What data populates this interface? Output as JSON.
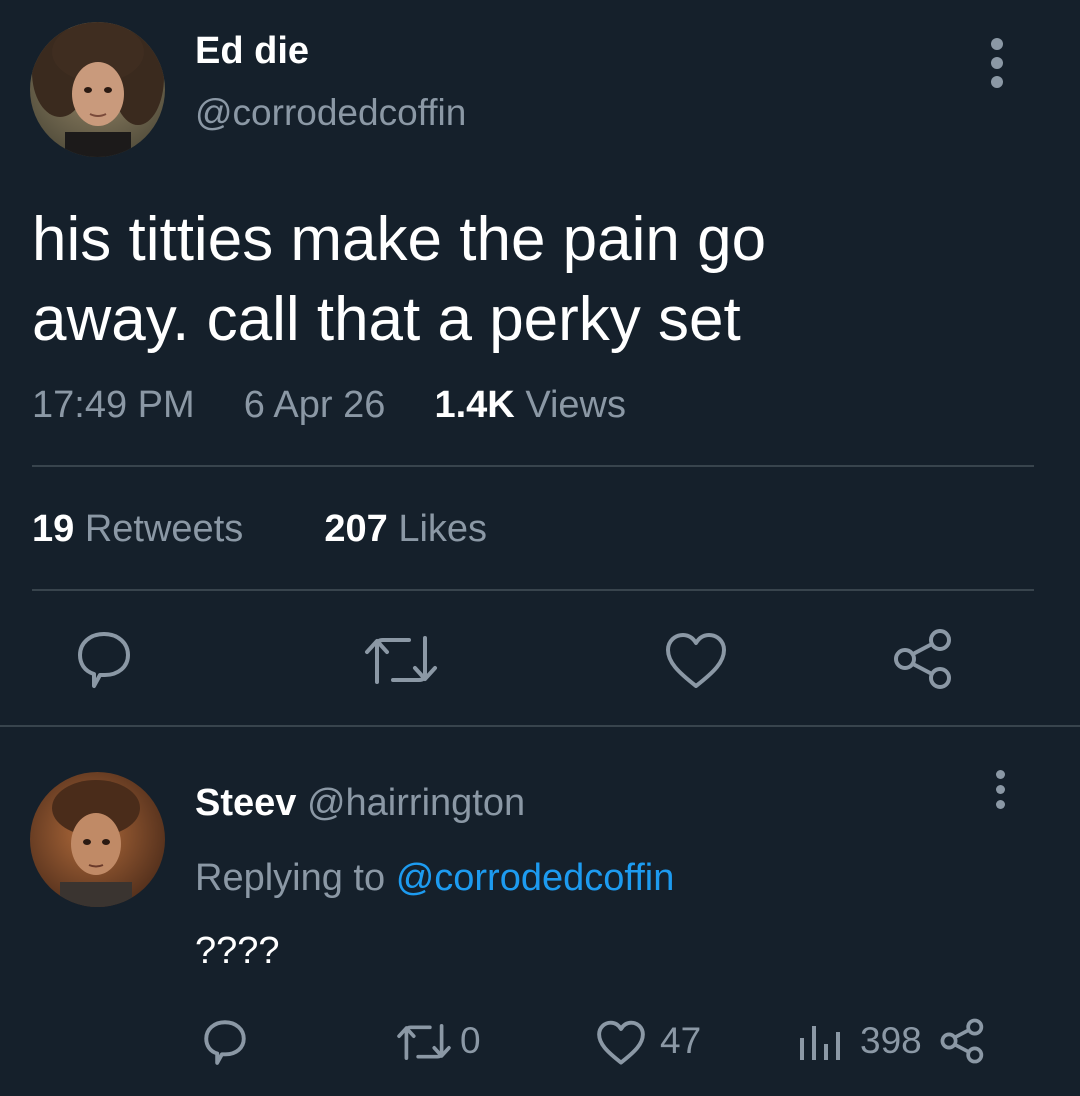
{
  "main_tweet": {
    "author_name": "Ed die",
    "author_handle": "@corrodedcoffin",
    "text_line1": "his titties make the pain go",
    "text_line2": "away. call that a perky set",
    "time": "17:49 PM",
    "date": "6 Apr 26",
    "views_count": "1.4K",
    "views_label": "Views",
    "retweets_count": "19",
    "retweets_label": "Retweets",
    "likes_count": "207",
    "likes_label": "Likes",
    "actions": [
      "reply-icon",
      "retweet-icon",
      "like-icon",
      "share-icon"
    ]
  },
  "reply": {
    "author_name": "Steev",
    "author_handle": "@hairrington",
    "replying_prefix": "Replying to",
    "replying_handle": "@corrodedcoffin",
    "text": "????",
    "retweet_count": "0",
    "like_count": "47",
    "view_count": "398",
    "actions": [
      "reply-icon",
      "retweet-icon",
      "like-icon",
      "views-icon",
      "share-icon"
    ]
  },
  "colors": {
    "background": "#15202b",
    "primary_text": "#ffffff",
    "secondary_text": "#8b98a5",
    "divider": "#38444d",
    "accent_link": "#1d9bf0"
  }
}
